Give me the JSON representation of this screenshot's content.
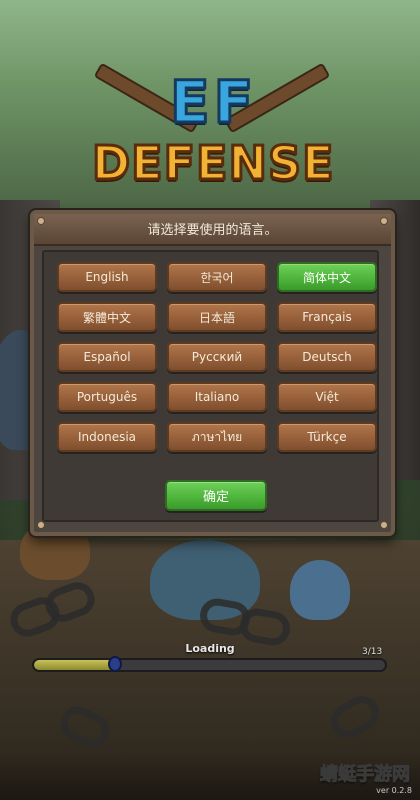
{
  "logo": {
    "line1": "EF",
    "line2": "DEFENSE"
  },
  "dialog": {
    "title": "请选择要使用的语言。",
    "languages": [
      {
        "label": "English",
        "selected": false
      },
      {
        "label": "한국어",
        "selected": false
      },
      {
        "label": "简体中文",
        "selected": true
      },
      {
        "label": "繁體中文",
        "selected": false
      },
      {
        "label": "日本語",
        "selected": false
      },
      {
        "label": "Français",
        "selected": false
      },
      {
        "label": "Español",
        "selected": false
      },
      {
        "label": "Русский",
        "selected": false
      },
      {
        "label": "Deutsch",
        "selected": false
      },
      {
        "label": "Português",
        "selected": false
      },
      {
        "label": "Italiano",
        "selected": false
      },
      {
        "label": "Việt",
        "selected": false
      },
      {
        "label": "Indonesia",
        "selected": false
      },
      {
        "label": "ภาษาไทย",
        "selected": false
      },
      {
        "label": "Türkçe",
        "selected": false
      }
    ],
    "confirm_label": "确定"
  },
  "loading": {
    "label": "Loading",
    "count": "3/13",
    "progress": 0.23
  },
  "footer": {
    "watermark": "蜻蜓手游网",
    "version": "ver 0.2.8"
  },
  "colors": {
    "button_brown": "#96603a",
    "button_green": "#4fb53c",
    "panel": "#4d4640",
    "logo_blue": "#3aa6e0",
    "logo_gold": "#f2b233"
  }
}
